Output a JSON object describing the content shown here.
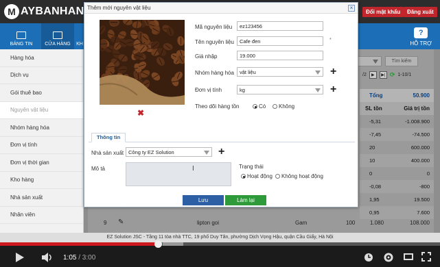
{
  "topbar": {
    "logo_letter": "M",
    "logo_text": "AYBANHANG",
    "change_password": "Đổi mật khẩu",
    "logout": "Đăng xuất"
  },
  "nav": {
    "items": [
      "BÁNG TIN",
      "CỬA HÀNG",
      "KH"
    ],
    "help": "HỖ TRỢ"
  },
  "sidebar": {
    "items": [
      "Hàng hóa",
      "Dịch vụ",
      "Gói thuê bao",
      "Nguyên vật liệu",
      "Nhóm hàng hóa",
      "Đơn vị tính",
      "Đơn vị thời gian",
      "Kho hàng",
      "Nhà sản xuất",
      "Nhân viên"
    ],
    "active_index": 3
  },
  "main": {
    "search_button": "Tìm kiếm",
    "pager_page": "/2",
    "pager_range": "1-10/1",
    "summary_label": "Tổng",
    "summary_value": "50.900",
    "columns": [
      "SL tồn",
      "Giá trị tồn"
    ],
    "rows": [
      [
        "-5,31",
        "-1.008.900"
      ],
      [
        "-7,45",
        "-74.500"
      ],
      [
        "20",
        "600.000"
      ],
      [
        "10",
        "400.000"
      ],
      [
        "0",
        "0"
      ],
      [
        "-0,08",
        "-800"
      ],
      [
        "1,95",
        "19.500"
      ],
      [
        "0,95",
        "7.600"
      ]
    ],
    "last_row": {
      "index": "9",
      "name": "lipton goi",
      "unit": "Gam",
      "qty": "100",
      "stock": "1.080",
      "value": "108.000"
    }
  },
  "modal": {
    "title": "Thêm mới nguyên vật liệu",
    "fields": {
      "code_label": "Mã nguyên liệu",
      "code_value": "ez123456",
      "name_label": "Tên nguyên liệu",
      "name_value": "Cafe đen",
      "price_label": "Giá nhập",
      "price_value": "19.000",
      "group_label": "Nhóm hàng hóa",
      "group_value": "vật liệu",
      "unit_label": "Đơn vị tính",
      "unit_value": "kg",
      "track_label": "Theo dõi hàng tồn",
      "track_yes": "Có",
      "track_no": "Không"
    },
    "tab_info": "Thông tin",
    "manufacturer_label": "Nhà sản xuất",
    "manufacturer_value": "Công ty EZ Solution",
    "description_label": "Mô tả",
    "status_label": "Trạng thái",
    "status_active": "Hoạt động",
    "status_inactive": "Không hoạt động",
    "save_button": "Lưu",
    "reset_button": "Làm lại"
  },
  "status_text": "EZ Solution JSC - Tầng 11 tòa nhà TTC, 19 phố Duy Tân, phường Dịch Vọng Hậu, quận Cầu Giấy, Hà Nội",
  "video": {
    "current_time": "1:05",
    "total_time": "/ 3:00",
    "progress_fraction": 0.361
  },
  "icons": [
    "play-icon",
    "volume-icon",
    "settings-icon",
    "fullscreen-icon",
    "clock-icon",
    "close-icon",
    "plus-icon",
    "delete-x-icon",
    "edit-pencil-icon"
  ],
  "colors": {
    "brand_red": "#c0262b",
    "nav_blue": "#1c6fb7",
    "save_blue": "#2c5fa3",
    "reset_green": "#2f9a3a",
    "video_red": "#cc181e"
  }
}
